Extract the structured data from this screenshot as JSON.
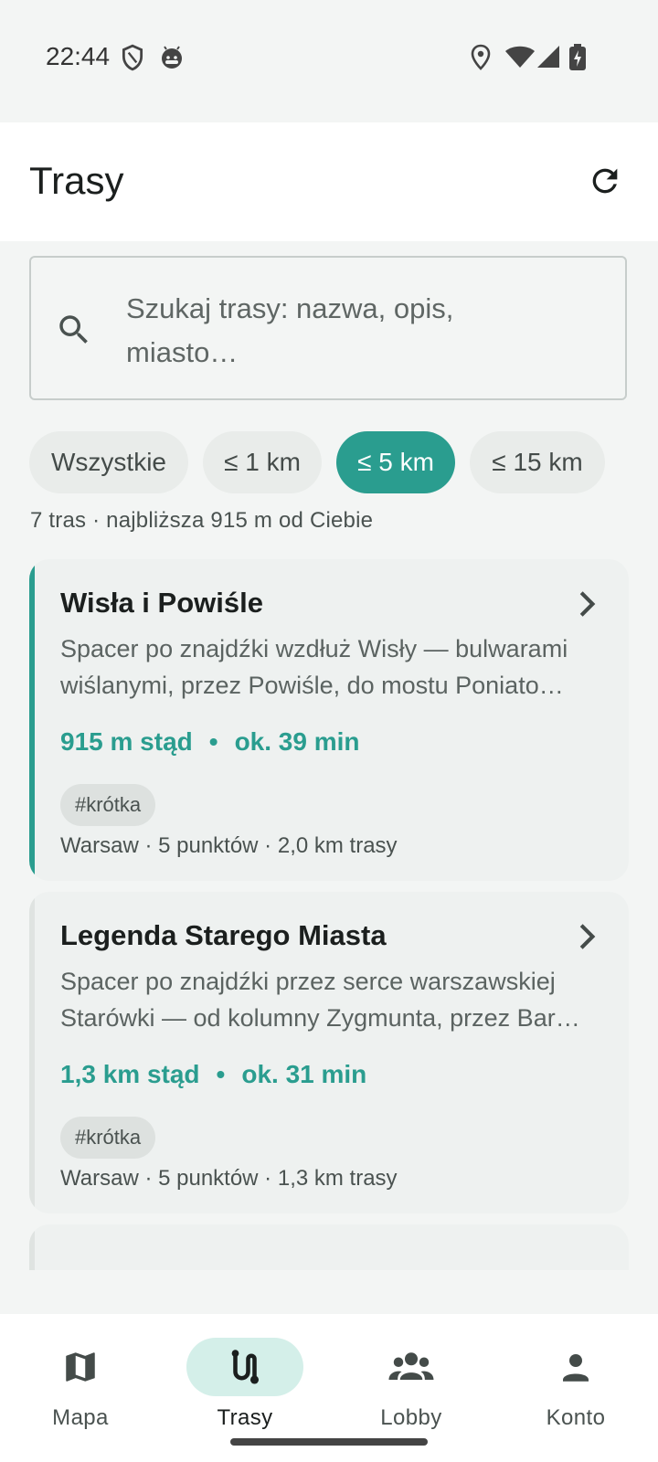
{
  "status_bar": {
    "time": "22:44",
    "left_icons": [
      "shield-icon",
      "android-face-icon"
    ],
    "right_icons": [
      "location-icon",
      "wifi-icon",
      "signal-icon",
      "battery-charging-icon"
    ]
  },
  "app_bar": {
    "title": "Trasy",
    "refresh_icon": "refresh-icon"
  },
  "search": {
    "placeholder_line1": "Szukaj trasy: nazwa, opis,",
    "placeholder_line2": "miasto…",
    "icon": "search-icon"
  },
  "filters": {
    "chips": [
      {
        "label": "Wszystkie",
        "selected": false
      },
      {
        "label": "≤ 1 km",
        "selected": false
      },
      {
        "label": "≤ 5 km",
        "selected": true
      },
      {
        "label": "≤ 15 km",
        "selected": false
      }
    ]
  },
  "summary": "7 tras · najbliższa 915 m od Ciebie",
  "routes": [
    {
      "title": "Wisła i Powiśle",
      "desc_line1": "Spacer po znajdźki wzdłuż Wisły — bulwarami",
      "desc_line2": "wiślanymi, przez Powiśle, do mostu Poniato…",
      "distance": "915 m stąd",
      "dot": "•",
      "duration": "ok. 39 min",
      "tag": "#krótka",
      "footer": "Warsaw · 5 punktów · 2,0 km trasy",
      "active": true
    },
    {
      "title": "Legenda Starego Miasta",
      "desc_line1": "Spacer po znajdźki przez serce warszawskiej",
      "desc_line2": "Starówki — od kolumny Zygmunta, przez Bar…",
      "distance": "1,3 km stąd",
      "dot": "•",
      "duration": "ok. 31 min",
      "tag": "#krótka",
      "footer": "Warsaw · 5 punktów · 1,3 km trasy",
      "active": false
    }
  ],
  "bottom_nav": [
    {
      "label": "Mapa",
      "icon": "map-icon",
      "active": false
    },
    {
      "label": "Trasy",
      "icon": "route-icon",
      "active": true
    },
    {
      "label": "Lobby",
      "icon": "group-icon",
      "active": false
    },
    {
      "label": "Konto",
      "icon": "person-icon",
      "active": false
    }
  ],
  "colors": {
    "accent": "#2a9d8f",
    "background": "#f3f5f4",
    "card": "#eef1f0"
  }
}
